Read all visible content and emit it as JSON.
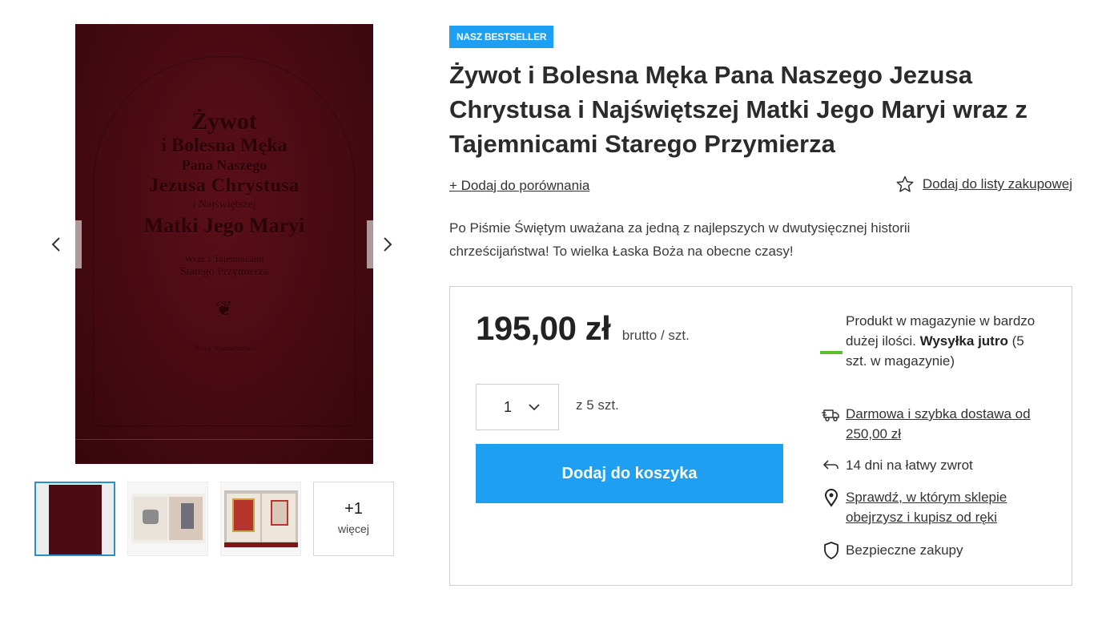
{
  "gallery": {
    "prev_icon": "chevron-left-icon",
    "next_icon": "chevron-right-icon",
    "cover": {
      "line1": "Żywot",
      "line2": "i Bolesna Męka",
      "line3": "Pana Naszego",
      "line4": "Jezusa Chrystusa",
      "line5": "i Najświętszej",
      "line6": "Matki Jego Maryi",
      "line7": "Wraz z Tajemnicami",
      "line8": "Starego Przymierza",
      "ornament": "❦",
      "publisher": "Nowy Wydawnictwo"
    },
    "more": {
      "count": "+1",
      "label": "więcej"
    }
  },
  "product": {
    "badge": "NASZ BESTSELLER",
    "title": "Żywot i Bolesna Męka Pana Naszego Jezusa Chrystusa i Najświętszej Matki Jego Maryi wraz z Tajemnicami Starego Przymierza",
    "compare_link": "+ Dodaj do porównania",
    "shopping_list_link": "Dodaj do listy zakupowej",
    "description": "Po Piśmie Świętym uważana za jedną z najlepszych w dwutysięcznej historii chrześcijaństwa! To wielka Łaska Boża na obecne czasy!"
  },
  "purchase": {
    "price": "195,00 zł",
    "price_unit": "brutto / szt.",
    "quantity": "1",
    "stock_of": "z 5 szt.",
    "add_to_cart": "Dodaj do koszyka"
  },
  "info": {
    "stock_text": "Produkt w magazynie w bardzo dużej ilości.",
    "shipping_bold": "Wysyłka jutro",
    "shipping_rest": " (5 szt. w magazynie)",
    "delivery": "Darmowa i szybka dostawa od 250,00 zł",
    "returns": "14 dni na łatwy zwrot",
    "store_check": "Sprawdź, w którym sklepie obejrzysz i kupisz od ręki",
    "safe": "Bezpieczne zakupy"
  },
  "colors": {
    "accent": "#1e9ff2",
    "stock_ok": "#5bbf2a",
    "thumb_active_border": "#2990cc"
  }
}
